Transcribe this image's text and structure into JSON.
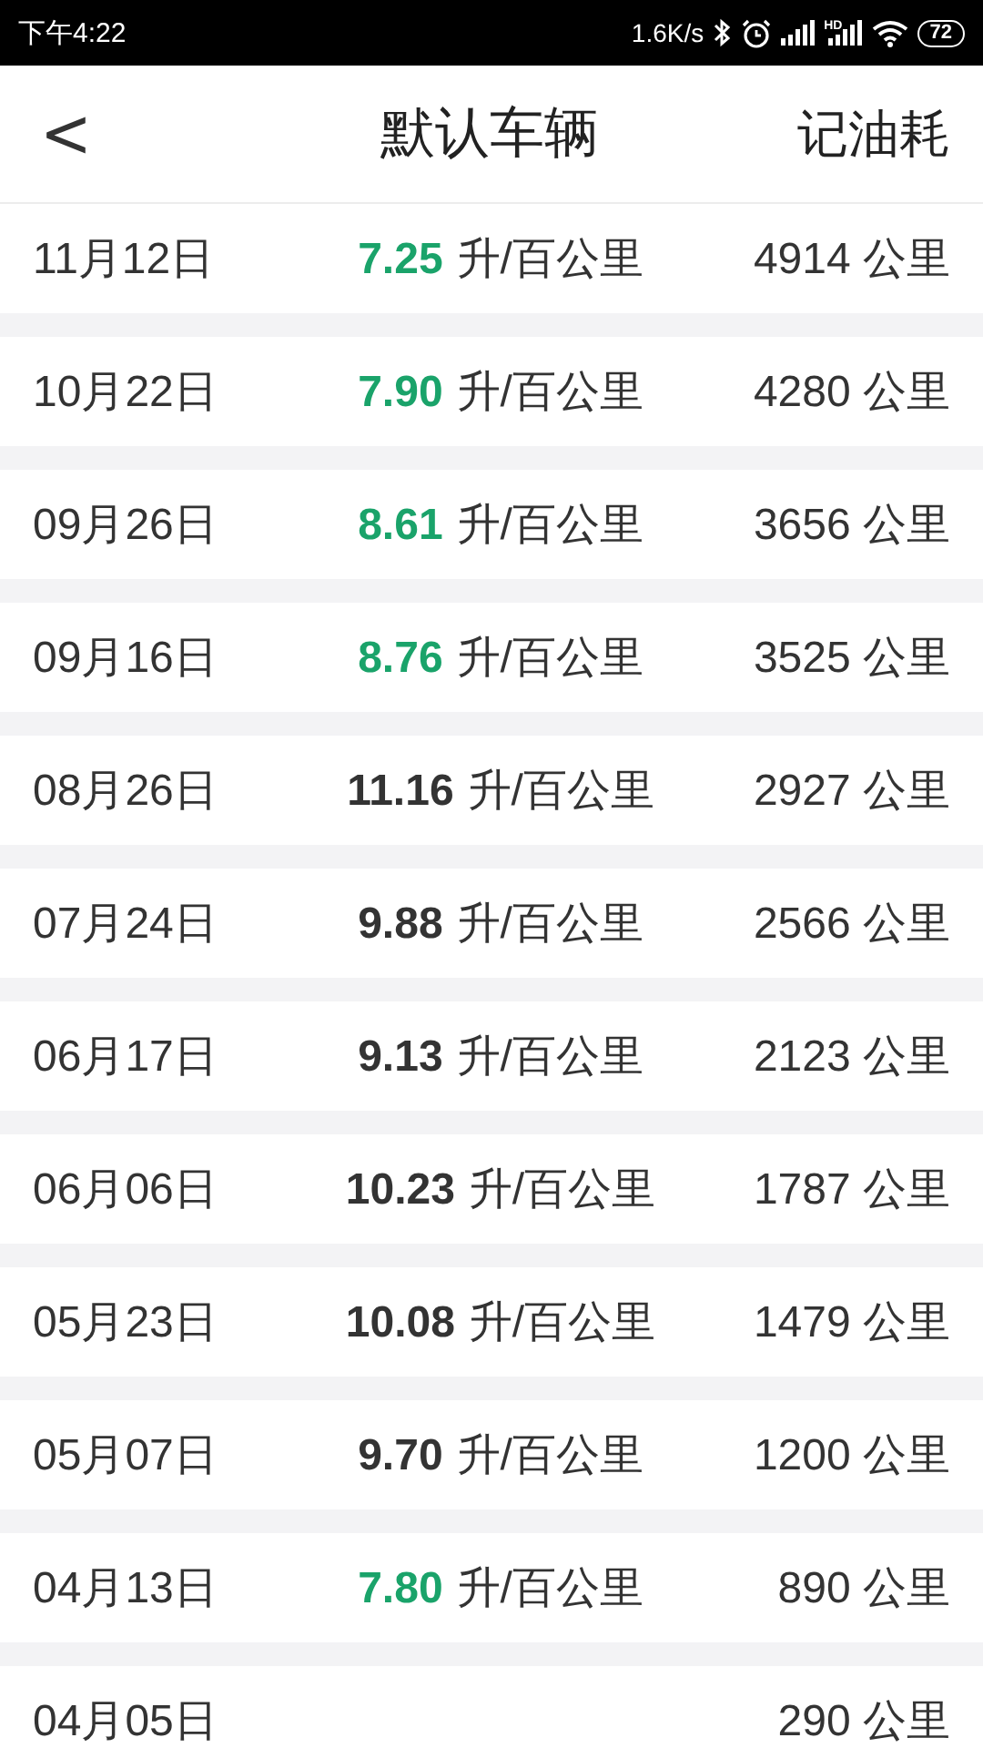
{
  "status_bar": {
    "time": "下午4:22",
    "speed": "1.6K/s",
    "hd_label": "HD",
    "battery": "72"
  },
  "header": {
    "back": "<",
    "title": "默认车辆",
    "action": "记油耗"
  },
  "records": [
    {
      "date": "11月12日",
      "consumption": "7.25",
      "unit": "升/百公里",
      "color": "#1aa36a",
      "distance": "4914 公里"
    },
    {
      "date": "10月22日",
      "consumption": "7.90",
      "unit": "升/百公里",
      "color": "#1aa36a",
      "distance": "4280 公里"
    },
    {
      "date": "09月26日",
      "consumption": "8.61",
      "unit": "升/百公里",
      "color": "#1aa36a",
      "distance": "3656 公里"
    },
    {
      "date": "09月16日",
      "consumption": "8.76",
      "unit": "升/百公里",
      "color": "#1aa36a",
      "distance": "3525 公里"
    },
    {
      "date": "08月26日",
      "consumption": "11.16",
      "unit": "升/百公里",
      "color": "#333333",
      "distance": "2927 公里"
    },
    {
      "date": "07月24日",
      "consumption": "9.88",
      "unit": "升/百公里",
      "color": "#333333",
      "distance": "2566 公里"
    },
    {
      "date": "06月17日",
      "consumption": "9.13",
      "unit": "升/百公里",
      "color": "#333333",
      "distance": "2123 公里"
    },
    {
      "date": "06月06日",
      "consumption": "10.23",
      "unit": "升/百公里",
      "color": "#333333",
      "distance": "1787 公里"
    },
    {
      "date": "05月23日",
      "consumption": "10.08",
      "unit": "升/百公里",
      "color": "#333333",
      "distance": "1479 公里"
    },
    {
      "date": "05月07日",
      "consumption": "9.70",
      "unit": "升/百公里",
      "color": "#333333",
      "distance": "1200 公里"
    },
    {
      "date": "04月13日",
      "consumption": "7.80",
      "unit": "升/百公里",
      "color": "#1aa36a",
      "distance": "890 公里"
    },
    {
      "date": "04月05日",
      "distance": "290 公里"
    }
  ]
}
